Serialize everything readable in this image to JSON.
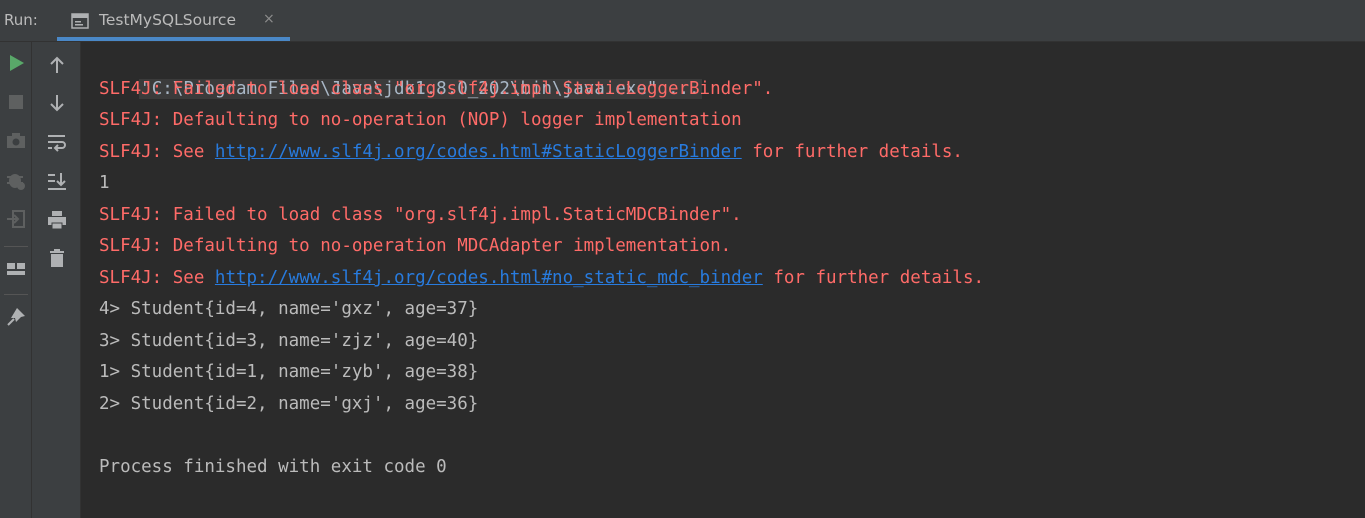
{
  "run": {
    "label": "Run:",
    "tab_title": "TestMySQLSource",
    "tab_close": "×"
  },
  "toolbar": {
    "left": [
      "run-icon",
      "stop-icon",
      "camera-icon",
      "debug-settings-icon",
      "exit-icon",
      "layout-icon",
      "pin-icon"
    ],
    "right": [
      "arrow-up-icon",
      "arrow-down-icon",
      "soft-wrap-icon",
      "scroll-to-end-icon",
      "print-icon",
      "trash-icon"
    ]
  },
  "console": {
    "cmd": "\"C:\\Program Files\\Java\\jdk1.8.0_202\\bin\\java.exe\" ...",
    "l1": "SLF4J: Failed to load class \"org.slf4j.impl.StaticLoggerBinder\".",
    "l2": "SLF4J: Defaulting to no-operation (NOP) logger implementation",
    "l3_pre": "SLF4J: See ",
    "l3_link": "http://www.slf4j.org/codes.html#StaticLoggerBinder",
    "l3_post": " for further details.",
    "l4": "1",
    "l5": "SLF4J: Failed to load class \"org.slf4j.impl.StaticMDCBinder\".",
    "l6": "SLF4J: Defaulting to no-operation MDCAdapter implementation.",
    "l7_pre": "SLF4J: See ",
    "l7_link": "http://www.slf4j.org/codes.html#no_static_mdc_binder",
    "l7_post": " for further details.",
    "l8": "4> Student{id=4, name='gxz', age=37}",
    "l9": "3> Student{id=3, name='zjz', age=40}",
    "l10": "1> Student{id=1, name='zyb', age=38}",
    "l11": "2> Student{id=2, name='gxj', age=36}",
    "l12": "Process finished with exit code 0"
  },
  "colors": {
    "error": "#ff6b68",
    "output": "#bbbbbb",
    "link": "#287bde",
    "run_green": "#59a869",
    "accent": "#4a88c7"
  }
}
